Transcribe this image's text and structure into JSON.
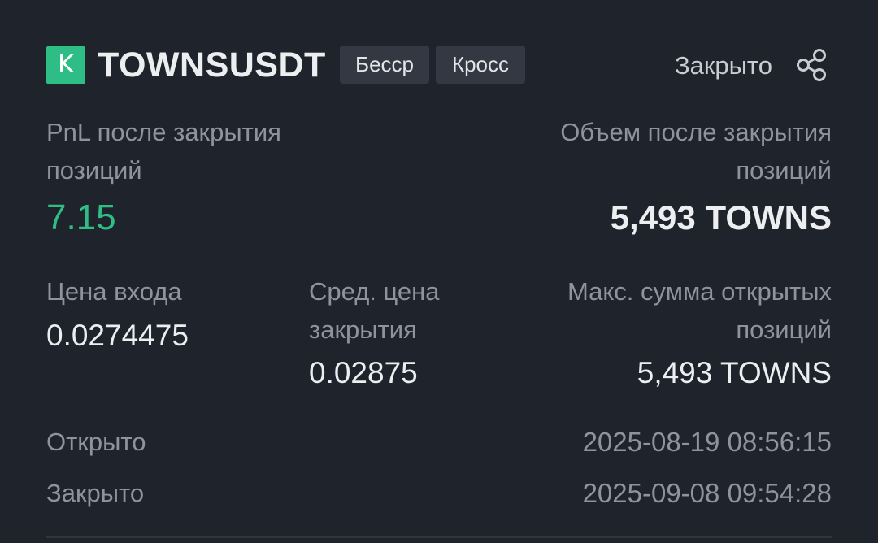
{
  "header": {
    "side_badge": "K",
    "symbol": "TOWNSUSDT",
    "tags": [
      "Бесср",
      "Кросс"
    ],
    "status": "Закрыто",
    "share_icon": "share-icon"
  },
  "pnl": {
    "label": "PnL после закрытия позиций",
    "value": "7.15",
    "color": "#2ebd85"
  },
  "volume": {
    "label": "Объем после закрытия позиций",
    "value": "5,493 TOWNS"
  },
  "entry_price": {
    "label": "Цена входа",
    "value": "0.0274475"
  },
  "avg_close_price": {
    "label": "Сред. цена закрытия",
    "value": "0.02875"
  },
  "max_open": {
    "label": "Макс. сумма открытых позиций",
    "value": "5,493 TOWNS"
  },
  "times": {
    "opened_label": "Открыто",
    "opened_value": "2025-08-19 08:56:15",
    "closed_label": "Закрыто",
    "closed_value": "2025-09-08 09:54:28"
  },
  "colors": {
    "background": "#1f232b",
    "accent_green": "#2ebd85",
    "tag_bg": "#333842"
  }
}
